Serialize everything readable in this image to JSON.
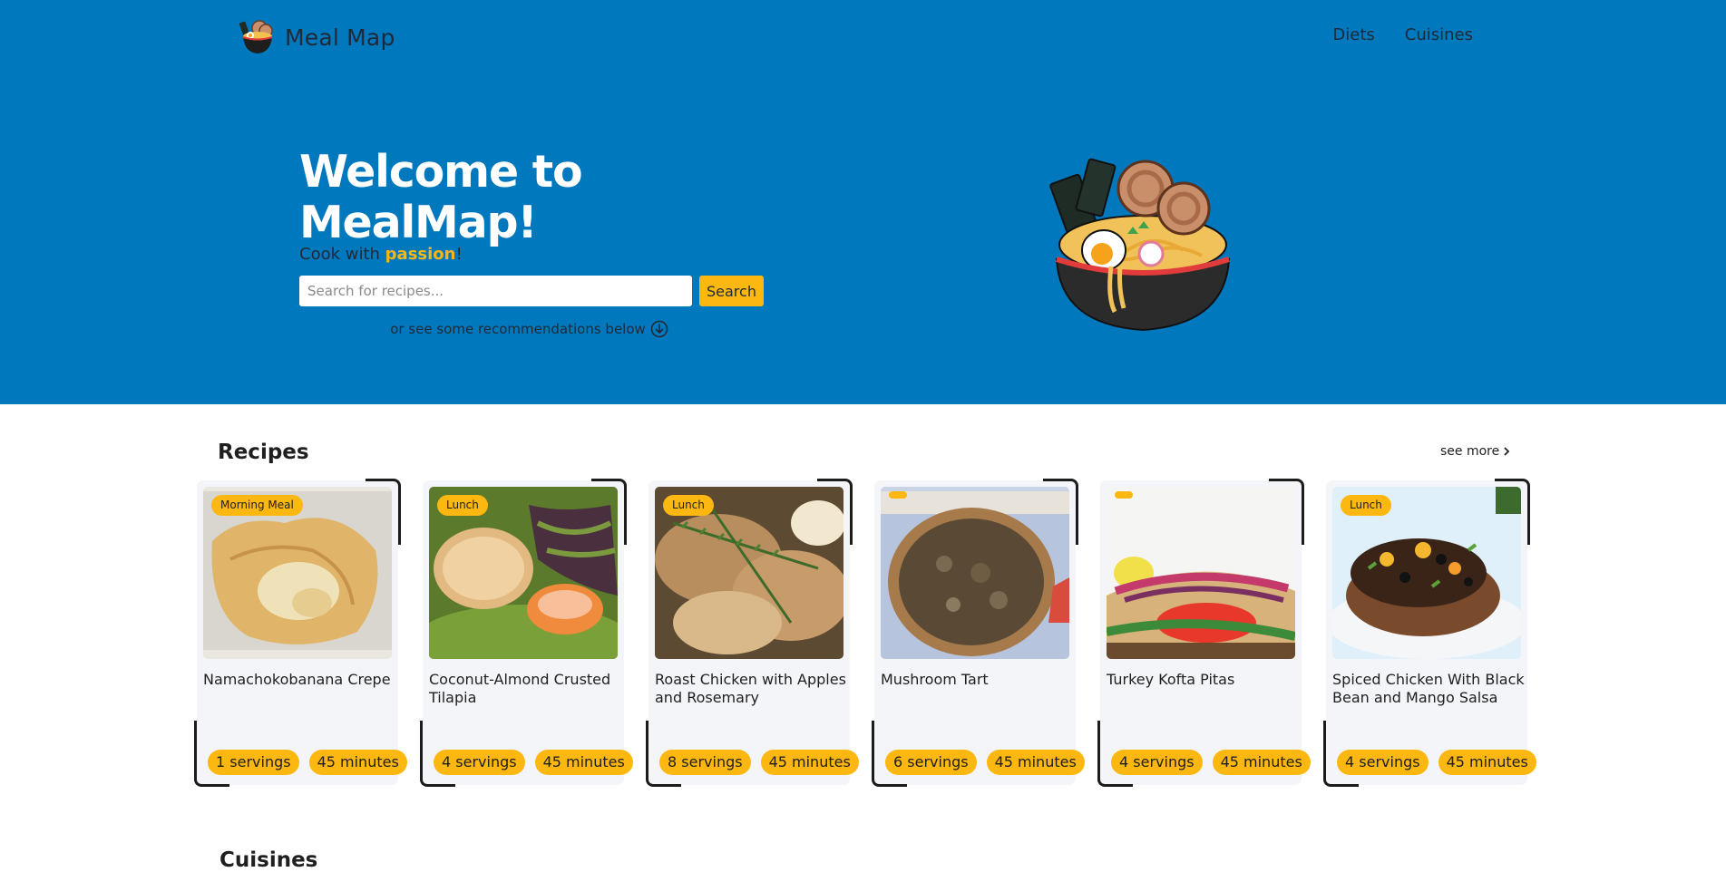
{
  "colors": {
    "brand": "#0078bd",
    "accent": "#fcb711"
  },
  "nav": {
    "brand_name": "Meal Map",
    "logo_icon": "ramen-bowl-icon",
    "links": [
      {
        "label": "Diets"
      },
      {
        "label": "Cuisines"
      }
    ]
  },
  "hero": {
    "heading": "Welcome to MealMap!",
    "tagline_prefix": "Cook with ",
    "tagline_accent": "passion",
    "tagline_suffix": "!",
    "search_placeholder": "Search for recipes...",
    "search_value": "",
    "search_button": "Search",
    "recommend_text": "or see some recommendations below",
    "recommend_icon": "arrow-down-circle-icon",
    "illustration_icon": "ramen-bowl-icon"
  },
  "recipes": {
    "title": "Recipes",
    "see_more": "see more",
    "see_more_icon": "chevron-right-icon",
    "items": [
      {
        "badge": "Morning Meal",
        "name": "Namachokobanana Crepe",
        "servings": "1 servings",
        "time": "45 minutes"
      },
      {
        "badge": "Lunch",
        "name": "Coconut-Almond Crusted Tilapia",
        "servings": "4 servings",
        "time": "45 minutes"
      },
      {
        "badge": "Lunch",
        "name": "Roast Chicken with Apples and Rosemary",
        "servings": "8 servings",
        "time": "45 minutes"
      },
      {
        "badge": "",
        "name": "Mushroom Tart",
        "servings": "6 servings",
        "time": "45 minutes"
      },
      {
        "badge": "",
        "name": "Turkey Kofta Pitas",
        "servings": "4 servings",
        "time": "45 minutes"
      },
      {
        "badge": "Lunch",
        "name": "Spiced Chicken With Black Bean and Mango Salsa",
        "servings": "4 servings",
        "time": "45 minutes"
      }
    ]
  },
  "next_section": {
    "title": "Cuisines"
  }
}
